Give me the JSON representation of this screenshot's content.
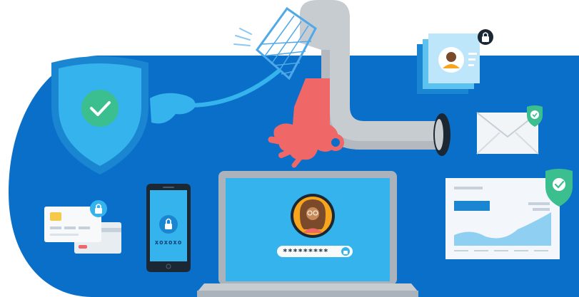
{
  "phone": {
    "label": "xoxoxo"
  },
  "laptop": {
    "password_mask": "*********"
  },
  "colors": {
    "background_blue": "#0a6fc9",
    "shield_light": "#34b3ec",
    "shield_dark": "#1a86d2",
    "check_green": "#3cbf8e",
    "hand_red": "#f06767",
    "pipe_gray": "#c7ccd1",
    "net_blue": "#4fa8e8"
  },
  "icons": [
    "shield-check-icon",
    "padlock-icon",
    "envelope-icon",
    "profile-card-icon",
    "credit-card-icon",
    "chart-icon",
    "avatar-icon",
    "net-icon"
  ]
}
